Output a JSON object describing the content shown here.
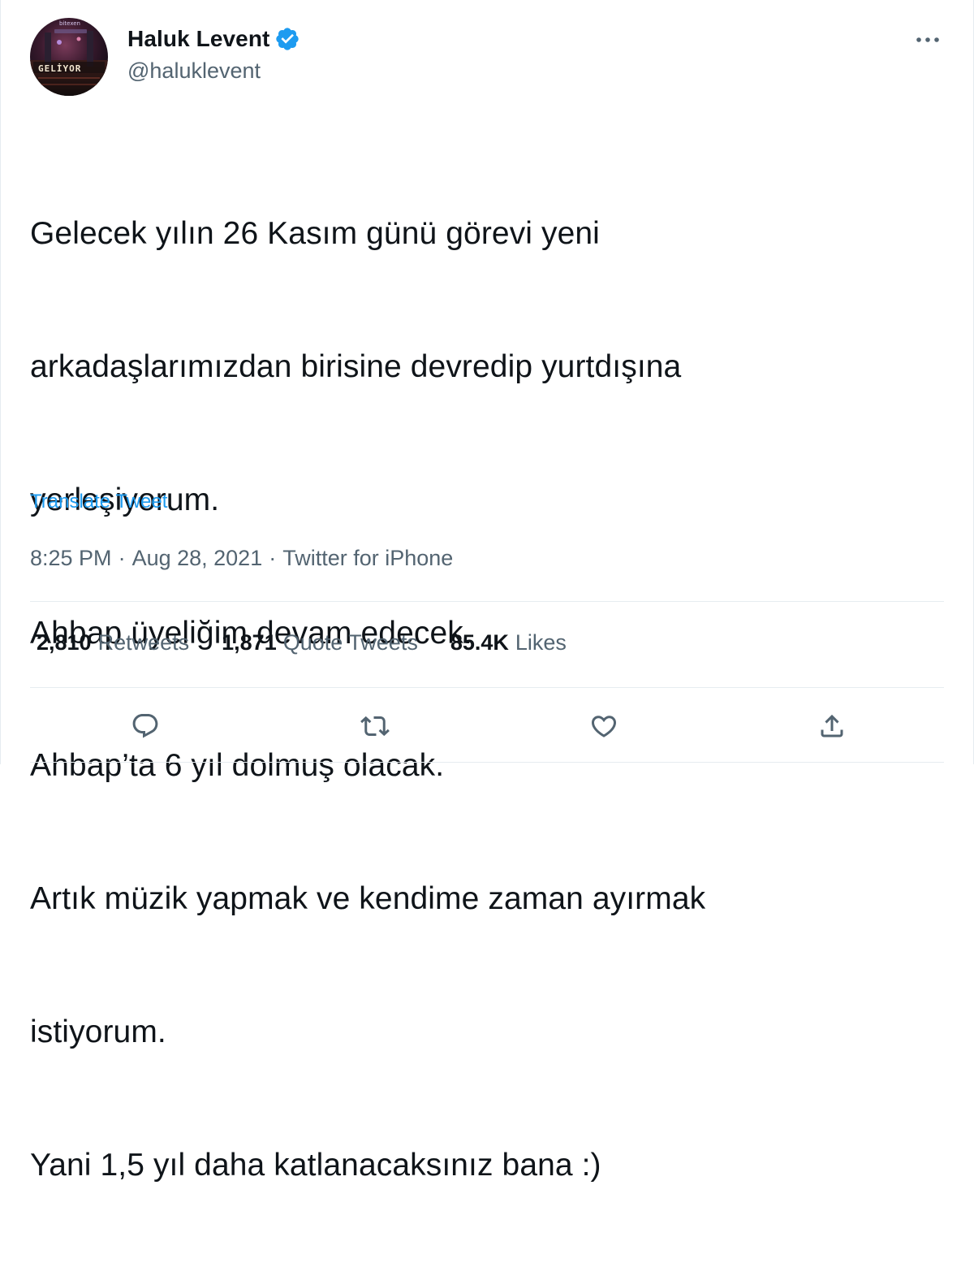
{
  "author": {
    "display_name": "Haluk Levent",
    "handle": "@haluklevent",
    "verified": true,
    "avatar": {
      "icon": "profile-avatar",
      "caption": "GELİYOR",
      "small_text": "bitexen"
    }
  },
  "tweet": {
    "lines": [
      "Gelecek yılın 26 Kasım günü görevi yeni",
      "arkadaşlarımızdan birisine devredip yurtdışına",
      "yerleşiyorum.",
      "Ahbap üyeliğim devam edecek.",
      "Ahbap’ta 6 yıl dolmuş olacak.",
      "Artık müzik yapmak ve kendime zaman ayırmak",
      "istiyorum.",
      "Yani 1,5 yıl daha katlanacaksınız bana :)"
    ],
    "translate_label": "Translate Tweet",
    "time": "8:25 PM",
    "date": "Aug 28, 2021",
    "source": "Twitter for iPhone",
    "separator": "·"
  },
  "stats": {
    "retweets": {
      "count": "2,810",
      "label": "Retweets"
    },
    "quotes": {
      "count": "1,871",
      "label": "Quote Tweets"
    },
    "likes": {
      "count": "85.4K",
      "label": "Likes"
    }
  },
  "actions": [
    {
      "icon": "reply-icon"
    },
    {
      "icon": "retweet-icon"
    },
    {
      "icon": "like-icon"
    },
    {
      "icon": "share-icon"
    }
  ],
  "colors": {
    "text": "#0f1419",
    "secondary": "#536471",
    "accent": "#1d9bf0",
    "divider": "#e6ecf0"
  }
}
